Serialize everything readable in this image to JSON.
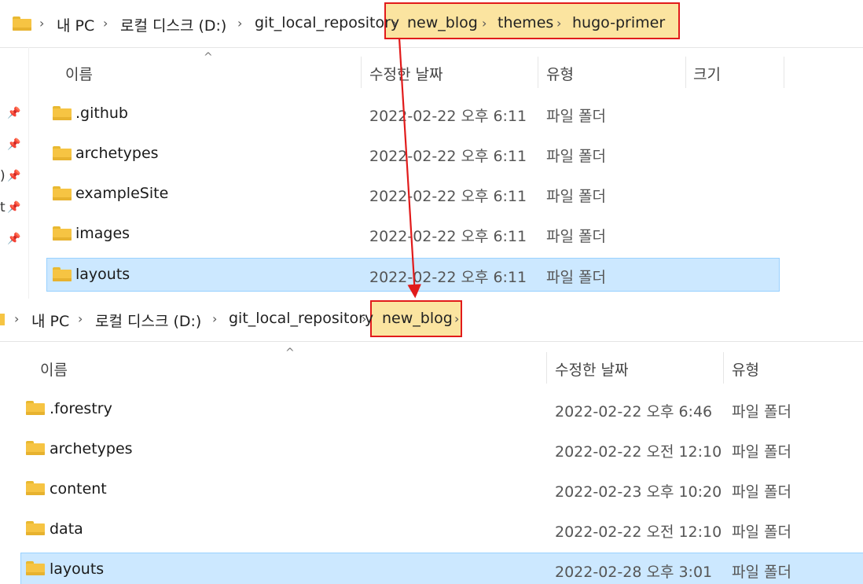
{
  "top": {
    "address": {
      "items": [
        "내 PC",
        "로컬 디스크 (D:)",
        "git_local_repository",
        "new_blog",
        "themes",
        "hugo-primer"
      ]
    },
    "columns": {
      "name": "이름",
      "date": "수정한 날짜",
      "type": "유형",
      "size": "크기"
    },
    "rows": [
      {
        "name": ".github",
        "date": "2022-02-22 오후 6:11",
        "type": "파일 폴더"
      },
      {
        "name": "archetypes",
        "date": "2022-02-22 오후 6:11",
        "type": "파일 폴더"
      },
      {
        "name": "exampleSite",
        "date": "2022-02-22 오후 6:11",
        "type": "파일 폴더"
      },
      {
        "name": "images",
        "date": "2022-02-22 오후 6:11",
        "type": "파일 폴더"
      },
      {
        "name": "layouts",
        "date": "2022-02-22 오후 6:11",
        "type": "파일 폴더",
        "selected": true
      }
    ],
    "sidebar_fragments": [
      ")",
      "t"
    ]
  },
  "bottom": {
    "address": {
      "items": [
        "내 PC",
        "로컬 디스크 (D:)",
        "git_local_repository",
        "new_blog"
      ]
    },
    "columns": {
      "name": "이름",
      "date": "수정한 날짜",
      "type": "유형"
    },
    "rows": [
      {
        "name": ".forestry",
        "date": "2022-02-22 오후 6:46",
        "type": "파일 폴더"
      },
      {
        "name": "archetypes",
        "date": "2022-02-22 오전 12:10",
        "type": "파일 폴더"
      },
      {
        "name": "content",
        "date": "2022-02-23 오후 10:20",
        "type": "파일 폴더"
      },
      {
        "name": "data",
        "date": "2022-02-22 오전 12:10",
        "type": "파일 폴더"
      },
      {
        "name": "layouts",
        "date": "2022-02-28 오후 3:01",
        "type": "파일 폴더",
        "selected": true
      }
    ]
  },
  "colors": {
    "highlight_border": "#e11b1b",
    "highlight_fill": "#fbe4a0",
    "selection": "#cce8ff",
    "arrow": "#e11b1b"
  },
  "icons": [
    "folder-icon",
    "chevron-right-icon",
    "pin-icon",
    "sort-caret-icon"
  ]
}
